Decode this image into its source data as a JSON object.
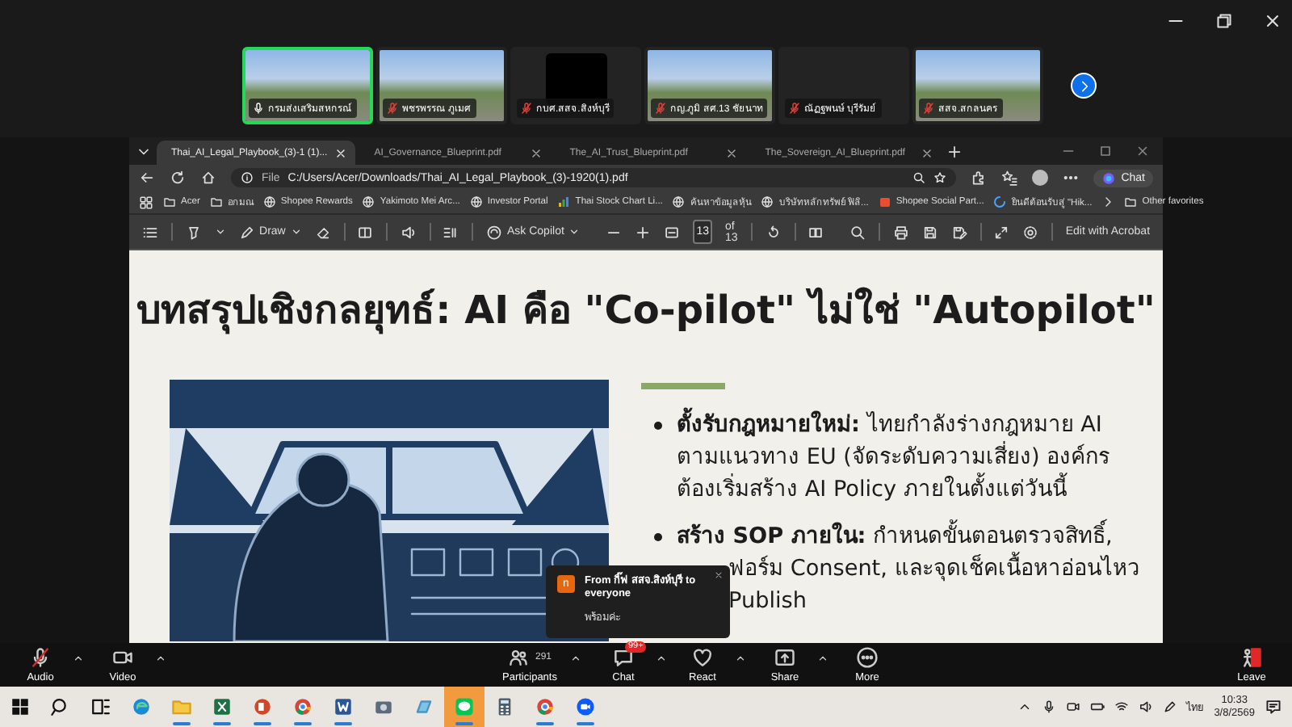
{
  "participants": [
    {
      "name": "กรมส่งเสริมสหกรณ์",
      "kind": "video",
      "selected": true,
      "muted": false
    },
    {
      "name": "พชรพรรณ ภูเมศ",
      "kind": "video",
      "selected": false,
      "muted": true
    },
    {
      "name": "กบศ.สสจ.สิงห์บุรี",
      "kind": "blank",
      "selected": false,
      "muted": true
    },
    {
      "name": "กญ.ภูมิ สศ.13 ชัยนาท",
      "kind": "video",
      "selected": false,
      "muted": true
    },
    {
      "name": "ณัฏฐพนษ์ บุรีรัมย์",
      "kind": "off",
      "selected": false,
      "muted": true
    },
    {
      "name": "สสจ.สกลนคร",
      "kind": "video",
      "selected": false,
      "muted": true
    }
  ],
  "browser": {
    "tabs": [
      {
        "label": "Thai_AI_Legal_Playbook_(3)-1 (1)...",
        "selected": true
      },
      {
        "label": "AI_Governance_Blueprint.pdf",
        "selected": false
      },
      {
        "label": "The_AI_Trust_Blueprint.pdf",
        "selected": false
      },
      {
        "label": "The_Sovereign_AI_Blueprint.pdf",
        "selected": false
      }
    ],
    "address": {
      "scheme": "File",
      "url": "C:/Users/Acer/Downloads/Thai_AI_Legal_Playbook_(3)-1920(1).pdf"
    },
    "chat_button": "Chat",
    "bookmarks": [
      {
        "kind": "folder",
        "label": "Acer"
      },
      {
        "kind": "folder",
        "label": "อกมณ"
      },
      {
        "kind": "globe",
        "label": "Shopee Rewards"
      },
      {
        "kind": "globe",
        "label": "Yakimoto Mei Arc..."
      },
      {
        "kind": "globe",
        "label": "Investor Portal"
      },
      {
        "kind": "chart",
        "label": "Thai Stock Chart Li..."
      },
      {
        "kind": "globe",
        "label": "ค้นหาข้อมูลหุ้น"
      },
      {
        "kind": "globe",
        "label": "บริษัทหลักทรัพย์ ฟิลิ..."
      },
      {
        "kind": "store",
        "label": "Shopee Social Part..."
      },
      {
        "kind": "spinner",
        "label": "ยินดีต้อนรับสู่ \"Hik..."
      }
    ],
    "other_favorites": "Other favorites"
  },
  "pdf_toolbar": {
    "draw": "Draw",
    "ask": "Ask Copilot",
    "page": "13",
    "page_count": "of 13",
    "edit": "Edit with Acrobat"
  },
  "slide": {
    "title": "บทสรุปเชิงกลยุทธ์: AI คือ \"Co-pilot\" ไม่ใช่ \"Autopilot\"",
    "bullets": [
      {
        "lines": [
          "**ตั้งรับกฎหมายใหม่:** ไทยกำลังร่างกฎหมาย AI",
          "ตามแนวทาง EU (จัดระดับความเสี่ยง) องค์กร",
          "ต้องเริ่มสร้าง AI Policy ภายในตั้งแต่วันนี้"
        ]
      },
      {
        "lines": [
          "**สร้าง SOP ภายใน:** กำหนดขั้นตอนตรวจสิทธิ์,",
          "ฟอร์ม Consent, และจุดเช็คเนื้อหาอ่อนไหว",
          "Publish"
        ]
      }
    ]
  },
  "notification": {
    "avatar": "n",
    "sender": "From กิ๊ฟ สสจ.สิงห์บุรี to everyone",
    "message": "พร้อมค่ะ"
  },
  "meeting_toolbar": [
    {
      "kind": "audio",
      "label": "Audio",
      "muted": true
    },
    {
      "kind": "video",
      "label": "Video"
    },
    {
      "kind": "participants",
      "label": "Participants",
      "count": "291"
    },
    {
      "kind": "chat",
      "label": "Chat",
      "badge": "99+"
    },
    {
      "kind": "react",
      "label": "React"
    },
    {
      "kind": "share",
      "label": "Share"
    },
    {
      "kind": "more",
      "label": "More"
    },
    {
      "kind": "leave",
      "label": "Leave"
    }
  ],
  "taskbar": {
    "apps": [
      {
        "kind": "start",
        "running": false,
        "highlighted": false
      },
      {
        "kind": "search",
        "running": false,
        "highlighted": false
      },
      {
        "kind": "taskview",
        "running": false,
        "highlighted": false
      },
      {
        "kind": "edge",
        "running": false,
        "highlighted": false
      },
      {
        "kind": "explorer",
        "running": true,
        "highlighted": false
      },
      {
        "kind": "excel",
        "running": true,
        "highlighted": false
      },
      {
        "kind": "powerpoint",
        "running": true,
        "highlighted": false
      },
      {
        "kind": "chrome",
        "running": true,
        "highlighted": false
      },
      {
        "kind": "word",
        "running": true,
        "highlighted": false
      },
      {
        "kind": "camera",
        "running": false,
        "highlighted": false
      },
      {
        "kind": "photos",
        "running": false,
        "highlighted": false
      },
      {
        "kind": "line",
        "running": true,
        "highlighted": true
      },
      {
        "kind": "calculator",
        "running": false,
        "highlighted": false
      },
      {
        "kind": "chrome",
        "running": true,
        "highlighted": false
      },
      {
        "kind": "zoom",
        "running": true,
        "highlighted": false
      }
    ],
    "language": "ไทย",
    "time": "10:33",
    "date": "3/8/2569"
  }
}
